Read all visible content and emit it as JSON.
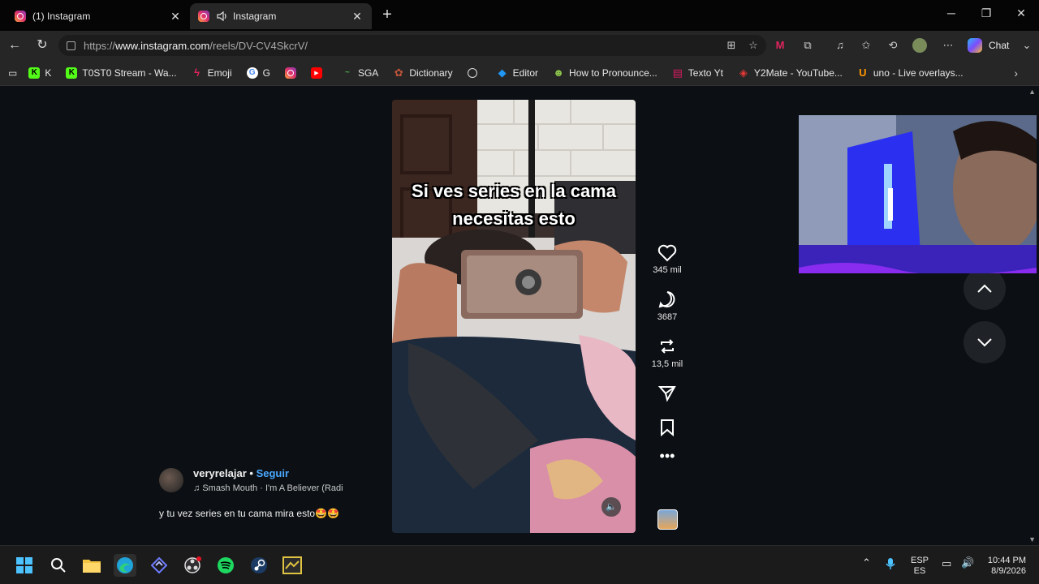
{
  "tabs": [
    {
      "label": "(1) Instagram",
      "active": false
    },
    {
      "label": "Instagram",
      "active": true
    }
  ],
  "address": {
    "prefix": "https://",
    "domain": "www.instagram.com",
    "path": "/reels/DV-CV4SkcrV/"
  },
  "chat_label": "Chat",
  "bookmarks": [
    {
      "label": "K",
      "icon": "kick-icon",
      "color": "#53fc18"
    },
    {
      "label": "T0ST0 Stream - Wa...",
      "icon": "kick-icon",
      "color": "#53fc18"
    },
    {
      "label": "Emoji",
      "icon": "bolt-icon",
      "color": "#e0245e"
    },
    {
      "label": "G",
      "icon": "google-icon",
      "color": "#4285f4"
    },
    {
      "label": "",
      "icon": "instagram-icon",
      "color": "#e1306c"
    },
    {
      "label": "",
      "icon": "youtube-icon",
      "color": "#ff0000"
    },
    {
      "label": "SGA",
      "icon": "sga-icon",
      "color": "#2e7d32"
    },
    {
      "label": "Dictionary",
      "icon": "dictionary-icon",
      "color": "#c2553a"
    },
    {
      "label": "",
      "icon": "chatgpt-icon",
      "color": "#ffffff"
    },
    {
      "label": "Editor",
      "icon": "editor-icon",
      "color": "#2196f3"
    },
    {
      "label": "How to Pronounce...",
      "icon": "pronounce-icon",
      "color": "#8bc34a"
    },
    {
      "label": "Texto Yt",
      "icon": "texto-icon",
      "color": "#d81b60"
    },
    {
      "label": "Y2Mate - YouTube...",
      "icon": "y2mate-icon",
      "color": "#e53935"
    },
    {
      "label": "uno - Live overlays...",
      "icon": "uno-icon",
      "color": "#ff9800"
    }
  ],
  "reel": {
    "overlay_line1": "Si ves series en la cama",
    "overlay_line2": "necesitas esto"
  },
  "actions": {
    "likes": "345 mil",
    "comments": "3687",
    "reposts": "13,5 mil"
  },
  "author": {
    "username": "veryrelajar",
    "separator": " • ",
    "follow": "Seguir",
    "song": "Smash Mouth · I'm A Believer (Radi"
  },
  "description": "y tu vez series en tu cama mira esto🤩🤩",
  "tray": {
    "lang1": "ESP",
    "lang2": "ES",
    "time": "10:44 PM",
    "date": "8/9/2026"
  },
  "colors": {
    "accent_follow": "#4aa8ff",
    "page_bg": "#0c1014"
  }
}
